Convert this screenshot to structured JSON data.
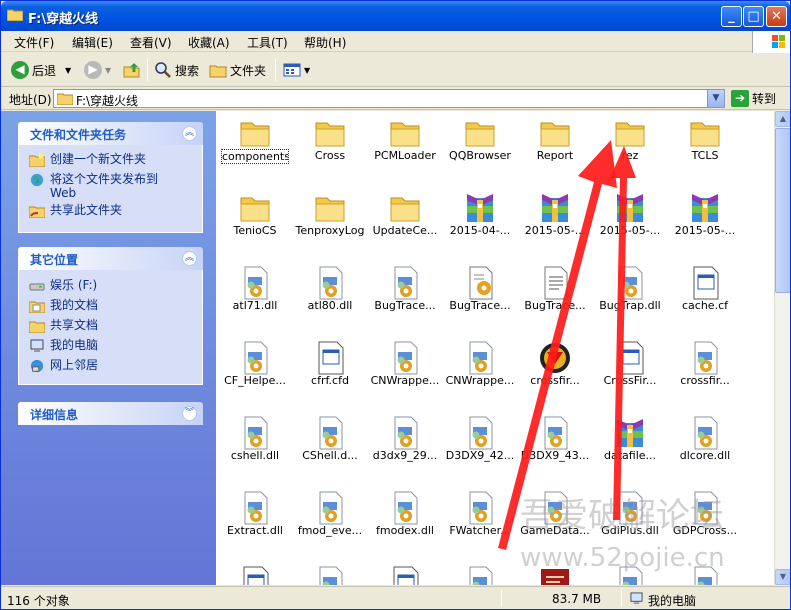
{
  "window": {
    "title": "F:\\穿越火线"
  },
  "menubar": [
    "文件(F)",
    "编辑(E)",
    "查看(V)",
    "收藏(A)",
    "工具(T)",
    "帮助(H)"
  ],
  "toolbar": {
    "back": "后退",
    "search": "搜索",
    "folders": "文件夹"
  },
  "address": {
    "label": "地址(D)",
    "value": "F:\\穿越火线",
    "go": "转到"
  },
  "sidebar": {
    "tasks": {
      "title": "文件和文件夹任务",
      "items": [
        "创建一个新文件夹",
        "将这个文件夹发布到",
        "Web",
        "共享此文件夹"
      ]
    },
    "places": {
      "title": "其它位置",
      "items": [
        "娱乐 (F:)",
        "我的文档",
        "共享文档",
        "我的电脑",
        "网上邻居"
      ]
    },
    "details": {
      "title": "详细信息"
    }
  },
  "files": [
    {
      "name": "components",
      "icon": "folder-icon"
    },
    {
      "name": "Cross",
      "icon": "folder-icon"
    },
    {
      "name": "PCMLoader",
      "icon": "folder-icon"
    },
    {
      "name": "QQBrowser",
      "icon": "folder-icon"
    },
    {
      "name": "Report",
      "icon": "folder-icon"
    },
    {
      "name": "rez",
      "icon": "folder-icon"
    },
    {
      "name": "TCLS",
      "icon": "folder-icon"
    },
    {
      "name": "TenioCS",
      "icon": "folder-icon"
    },
    {
      "name": "TenproxyLog",
      "icon": "folder-icon"
    },
    {
      "name": "UpdateCe...",
      "icon": "folder-icon"
    },
    {
      "name": "2015-04-...",
      "icon": "archive-icon"
    },
    {
      "name": "2015-05-...",
      "icon": "archive-icon"
    },
    {
      "name": "2015-05-...",
      "icon": "archive-icon"
    },
    {
      "name": "2015-05-...",
      "icon": "archive-icon"
    },
    {
      "name": "atl71.dll",
      "icon": "dll-icon"
    },
    {
      "name": "atl80.dll",
      "icon": "dll-icon"
    },
    {
      "name": "BugTrace...",
      "icon": "dll-icon"
    },
    {
      "name": "BugTrace...",
      "icon": "config-icon"
    },
    {
      "name": "BugTrace...",
      "icon": "text-file-icon"
    },
    {
      "name": "BugTrap.dll",
      "icon": "dll-icon"
    },
    {
      "name": "cache.cf",
      "icon": "window-file-icon"
    },
    {
      "name": "CF_Helpe...",
      "icon": "dll-icon"
    },
    {
      "name": "cfrf.cfd",
      "icon": "window-file-icon"
    },
    {
      "name": "CNWrappe...",
      "icon": "dll-icon"
    },
    {
      "name": "CNWrappe...",
      "icon": "dll-icon"
    },
    {
      "name": "crossfir...",
      "icon": "crossfire-icon"
    },
    {
      "name": "CrossFir...",
      "icon": "window-file-icon"
    },
    {
      "name": "crossfir...",
      "icon": "dll-icon"
    },
    {
      "name": "cshell.dll",
      "icon": "dll-icon"
    },
    {
      "name": "CShell.d...",
      "icon": "dll-icon"
    },
    {
      "name": "d3dx9_29...",
      "icon": "dll-icon"
    },
    {
      "name": "D3DX9_42...",
      "icon": "dll-icon"
    },
    {
      "name": "D3DX9_43...",
      "icon": "dll-icon"
    },
    {
      "name": "datafile...",
      "icon": "archive-icon"
    },
    {
      "name": "dlcore.dll",
      "icon": "dll-icon"
    },
    {
      "name": "Extract.dll",
      "icon": "dll-icon"
    },
    {
      "name": "fmod_eve...",
      "icon": "dll-icon"
    },
    {
      "name": "fmodex.dll",
      "icon": "dll-icon"
    },
    {
      "name": "FWatcher...",
      "icon": "dll-icon"
    },
    {
      "name": "GameData...",
      "icon": "dll-icon"
    },
    {
      "name": "GdiPlus.dll",
      "icon": "dll-icon"
    },
    {
      "name": "GDPCross...",
      "icon": "dll-icon"
    },
    {
      "name": "",
      "icon": "window-file-icon"
    },
    {
      "name": "",
      "icon": "dll-icon"
    },
    {
      "name": "",
      "icon": "window-file-icon"
    },
    {
      "name": "",
      "icon": "dll-icon"
    },
    {
      "name": "",
      "icon": "exe-icon"
    },
    {
      "name": "",
      "icon": "dll-icon"
    },
    {
      "name": "",
      "icon": "dll-icon"
    }
  ],
  "status": {
    "count": "116 个对象",
    "size": "83.7 MB",
    "location": "我的电脑"
  },
  "watermark": {
    "line1": "吾爱破解论坛",
    "line2": "www.52pojie.cn"
  },
  "colors": {
    "titlebar": "#0054e3",
    "sidebar": "#6b8ee0",
    "arrow": "#ff1a1a"
  }
}
